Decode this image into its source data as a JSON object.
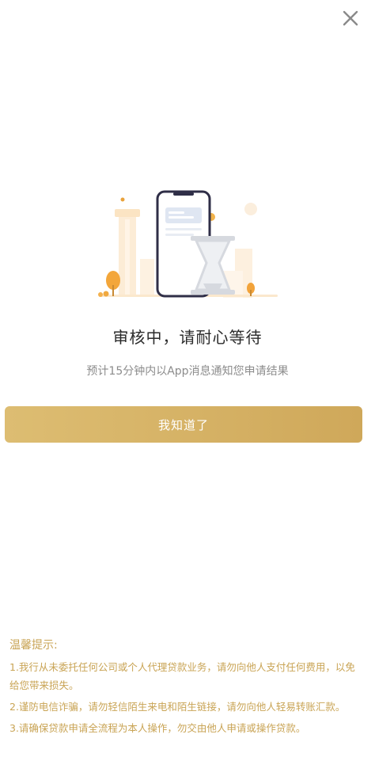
{
  "close": {
    "icon": "close-icon"
  },
  "status": {
    "title": "审核中，请耐心等待",
    "subtitle": "预计15分钟内以App消息通知您申请结果"
  },
  "button": {
    "label": "我知道了"
  },
  "tips": {
    "title": "温馨提示:",
    "items": [
      "1.我行从未委托任何公司或个人代理贷款业务，请勿向他人支付任何费用，以免给您带来损失。",
      "2.谨防电信诈骗，请勿轻信陌生来电和陌生链接，请勿向他人轻易转账汇款。",
      "3.请确保贷款申请全流程为本人操作，勿交由他人申请或操作贷款。"
    ]
  },
  "colors": {
    "accent": "#d4b064",
    "tip_text": "#c9a455",
    "title_text": "#2a2a2a",
    "subtitle_text": "#8c8c8c"
  }
}
